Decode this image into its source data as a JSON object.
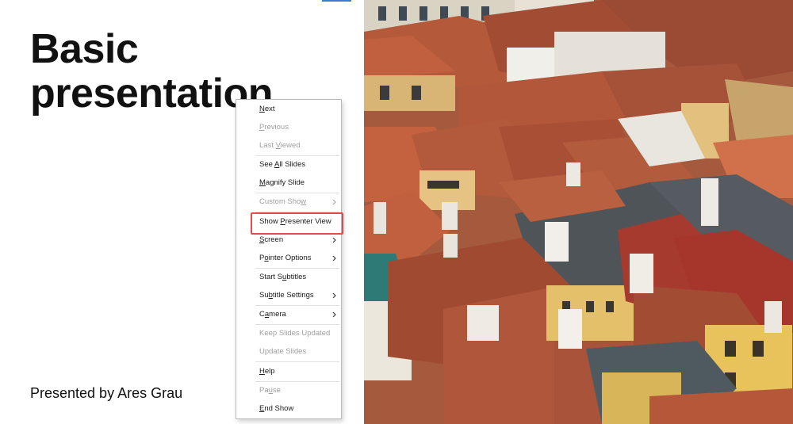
{
  "slide": {
    "title_line1": "Basic",
    "title_line2": "presentation",
    "subtitle": "Presented by Ares Grau",
    "image_alt": "Photo of terracotta rooftops of an old town",
    "colors": {
      "highlight": "#e44a4a",
      "menu_text": "#1a1a1a",
      "menu_disabled": "#a0a0a0"
    }
  },
  "context_menu": {
    "items": [
      {
        "pre": "",
        "key": "N",
        "post": "ext",
        "disabled": false,
        "submenu": false
      },
      {
        "pre": "",
        "key": "P",
        "post": "revious",
        "disabled": true,
        "submenu": false
      },
      {
        "pre": "Last ",
        "key": "V",
        "post": "iewed",
        "disabled": true,
        "submenu": false
      },
      {
        "pre": "See ",
        "key": "A",
        "post": "ll Slides",
        "disabled": false,
        "submenu": false
      },
      {
        "pre": "",
        "key": "M",
        "post": "agnify Slide",
        "disabled": false,
        "submenu": false
      },
      {
        "pre": "Custom Sho",
        "key": "w",
        "post": "",
        "disabled": true,
        "submenu": true
      },
      {
        "pre": "Show ",
        "key": "P",
        "post": "resenter View",
        "disabled": false,
        "submenu": false
      },
      {
        "pre": "",
        "key": "S",
        "post": "creen",
        "disabled": false,
        "submenu": true
      },
      {
        "pre": "P",
        "key": "o",
        "post": "inter Options",
        "disabled": false,
        "submenu": true
      },
      {
        "pre": "Start S",
        "key": "u",
        "post": "btitles",
        "disabled": false,
        "submenu": false
      },
      {
        "pre": "Su",
        "key": "b",
        "post": "title Settings",
        "disabled": false,
        "submenu": true
      },
      {
        "pre": "C",
        "key": "a",
        "post": "mera",
        "disabled": false,
        "submenu": true
      },
      {
        "pre": "Keep Slides Updated",
        "key": "",
        "post": "",
        "disabled": true,
        "submenu": false
      },
      {
        "pre": "Update Slides",
        "key": "",
        "post": "",
        "disabled": true,
        "submenu": false
      },
      {
        "pre": "",
        "key": "H",
        "post": "elp",
        "disabled": false,
        "submenu": false
      },
      {
        "pre": "Pa",
        "key": "u",
        "post": "se",
        "disabled": true,
        "submenu": false
      },
      {
        "pre": "",
        "key": "E",
        "post": "nd Show",
        "disabled": false,
        "submenu": false
      }
    ]
  }
}
